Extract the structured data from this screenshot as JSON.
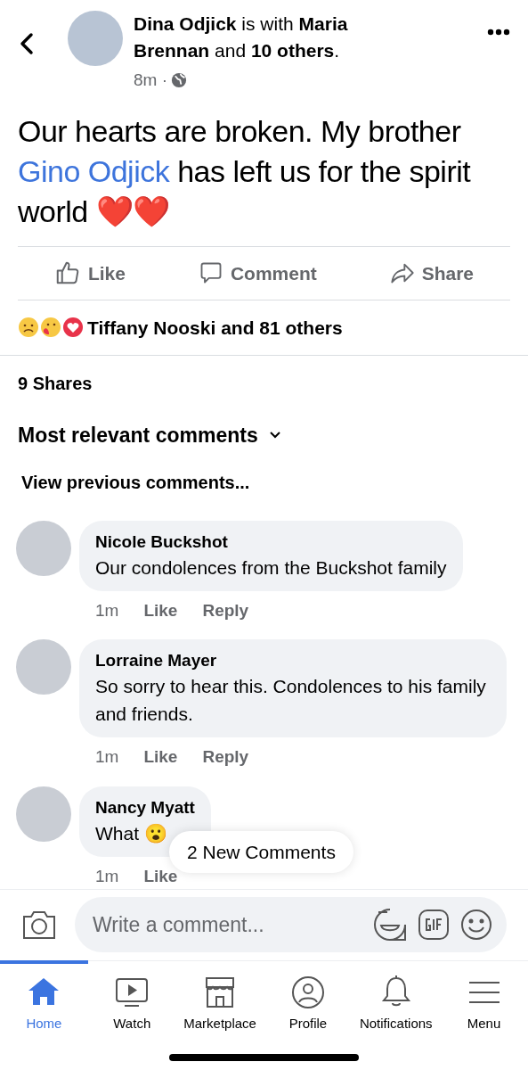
{
  "header": {
    "sentence": "**Dina Odjick** is with **Maria Brennan** and **10 others**.",
    "time": "8m",
    "separator": "·"
  },
  "post": {
    "text_before": "Our hearts are broken. My brother ",
    "link": "Gino Odjick",
    "text_after": " has left us for the spirit world",
    "hearts": "❤️❤️"
  },
  "actions": [
    {
      "kind": "like",
      "label": "Like"
    },
    {
      "kind": "comment",
      "label": "Comment"
    },
    {
      "kind": "share",
      "label": "Share"
    }
  ],
  "reactions": {
    "summary": "Tiffany Nooski and 81 others"
  },
  "shares": "9 Shares",
  "sort": "Most relevant comments",
  "view_previous": "View previous comments...",
  "comments": [
    {
      "author": "Nicole Buckshot",
      "text": "Our condolences from the Buckshot family",
      "time": "1m",
      "actions": [
        "Like",
        "Reply"
      ]
    },
    {
      "author": "Lorraine Mayer",
      "text": "So sorry to hear this. Condolences to his family and friends.",
      "time": "1m",
      "actions": [
        "Like",
        "Reply"
      ]
    },
    {
      "author": "Nancy Myatt",
      "text": "What 😮",
      "time": "1m",
      "actions": [
        "Like"
      ]
    }
  ],
  "new_comments": "2 New Comments",
  "composer": {
    "placeholder": "Write a comment..."
  },
  "tabs": [
    {
      "kind": "home",
      "label": "Home",
      "selected": true
    },
    {
      "kind": "watch",
      "label": "Watch",
      "selected": false
    },
    {
      "kind": "marketplace",
      "label": "Marketplace",
      "selected": false
    },
    {
      "kind": "profile",
      "label": "Profile",
      "selected": false
    },
    {
      "kind": "notifications",
      "label": "Notifications",
      "selected": false
    },
    {
      "kind": "menu",
      "label": "Menu",
      "selected": false
    }
  ]
}
